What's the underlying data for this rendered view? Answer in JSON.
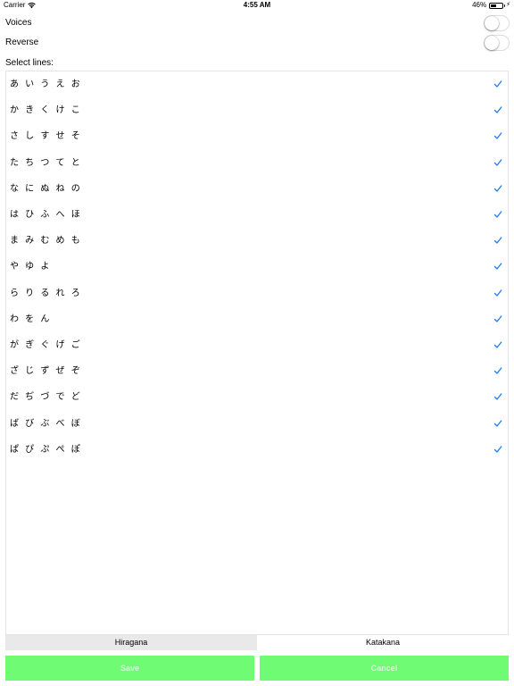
{
  "status_bar": {
    "carrier": "Carrier",
    "time": "4:55 AM",
    "battery_percent": "46%",
    "battery_level": 0.46,
    "icons": [
      "wifi-icon",
      "battery-icon",
      "charging-bolt-icon"
    ]
  },
  "settings": [
    {
      "label": "Voices",
      "on": false
    },
    {
      "label": "Reverse",
      "on": false
    }
  ],
  "lines_section": {
    "label": "Select lines:",
    "items": [
      {
        "label": "あ い う え お",
        "checked": true
      },
      {
        "label": "か き く け こ",
        "checked": true
      },
      {
        "label": "さ し す せ そ",
        "checked": true
      },
      {
        "label": "た ち つ て と",
        "checked": true
      },
      {
        "label": "な に ぬ ね の",
        "checked": true
      },
      {
        "label": "は ひ ふ へ ほ",
        "checked": true
      },
      {
        "label": "ま み む め も",
        "checked": true
      },
      {
        "label": "や ゆ よ",
        "checked": true
      },
      {
        "label": "ら り る れ ろ",
        "checked": true
      },
      {
        "label": "わ を ん",
        "checked": true
      },
      {
        "label": "が ぎ ぐ げ ご",
        "checked": true
      },
      {
        "label": "ざ じ ず ぜ ぞ",
        "checked": true
      },
      {
        "label": "だ ぢ づ で ど",
        "checked": true
      },
      {
        "label": "ば び ぶ べ ぼ",
        "checked": true
      },
      {
        "label": "ぱ ぴ ぷ ぺ ぽ",
        "checked": true
      }
    ]
  },
  "segmented_control": {
    "segments": [
      {
        "label": "Hiragana",
        "selected": true
      },
      {
        "label": "Katakana",
        "selected": false
      }
    ]
  },
  "actions": {
    "save_label": "Save",
    "cancel_label": "Cancel",
    "button_color": "#6ffb74",
    "check_color": "#1e7cf2"
  }
}
